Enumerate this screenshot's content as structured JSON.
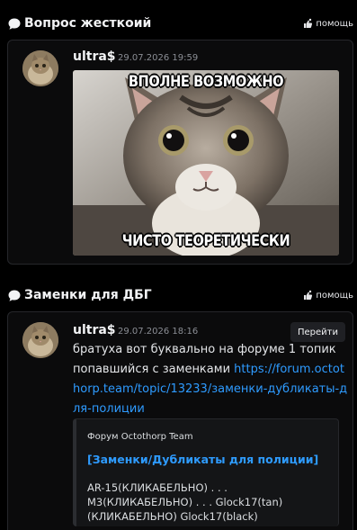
{
  "threads": [
    {
      "title": "Вопрос жесткоий",
      "help_label": "помощь",
      "message": {
        "username": "ultra$",
        "timestamp": "29.07.2026 19:59",
        "meme": {
          "top_text": "ВПОЛНЕ ВОЗМОЖНО",
          "bottom_text": "ЧИСТО ТЕОРЕТИЧЕСКИ"
        }
      }
    },
    {
      "title": "Заменки для ДБГ",
      "help_label": "помощь",
      "message": {
        "username": "ultra$",
        "timestamp": "29.07.2026 18:16",
        "goto_label": "Перейти",
        "text": "братуха вот буквально на форуме 1 топик попавшийся с заменками",
        "link": "https://forum.octothorp.team/topic/13233/заменки-дубликаты-для-полиции",
        "embed": {
          "provider": "Форум Octothorp Team",
          "title": "[Заменки/Дубликаты для полиции]",
          "description": "AR-15(КЛИКАБЕЛЬНО) . . . M3(КЛИКАБЕЛЬНО) . . . Glock17(tan) (КЛИКАБЕЛЬНО) Glock17(black)"
        }
      }
    }
  ],
  "colors": {
    "background": "#000000",
    "card": "#0b0b0c",
    "link": "#2e9bff",
    "timestamp": "#8b8e95"
  }
}
